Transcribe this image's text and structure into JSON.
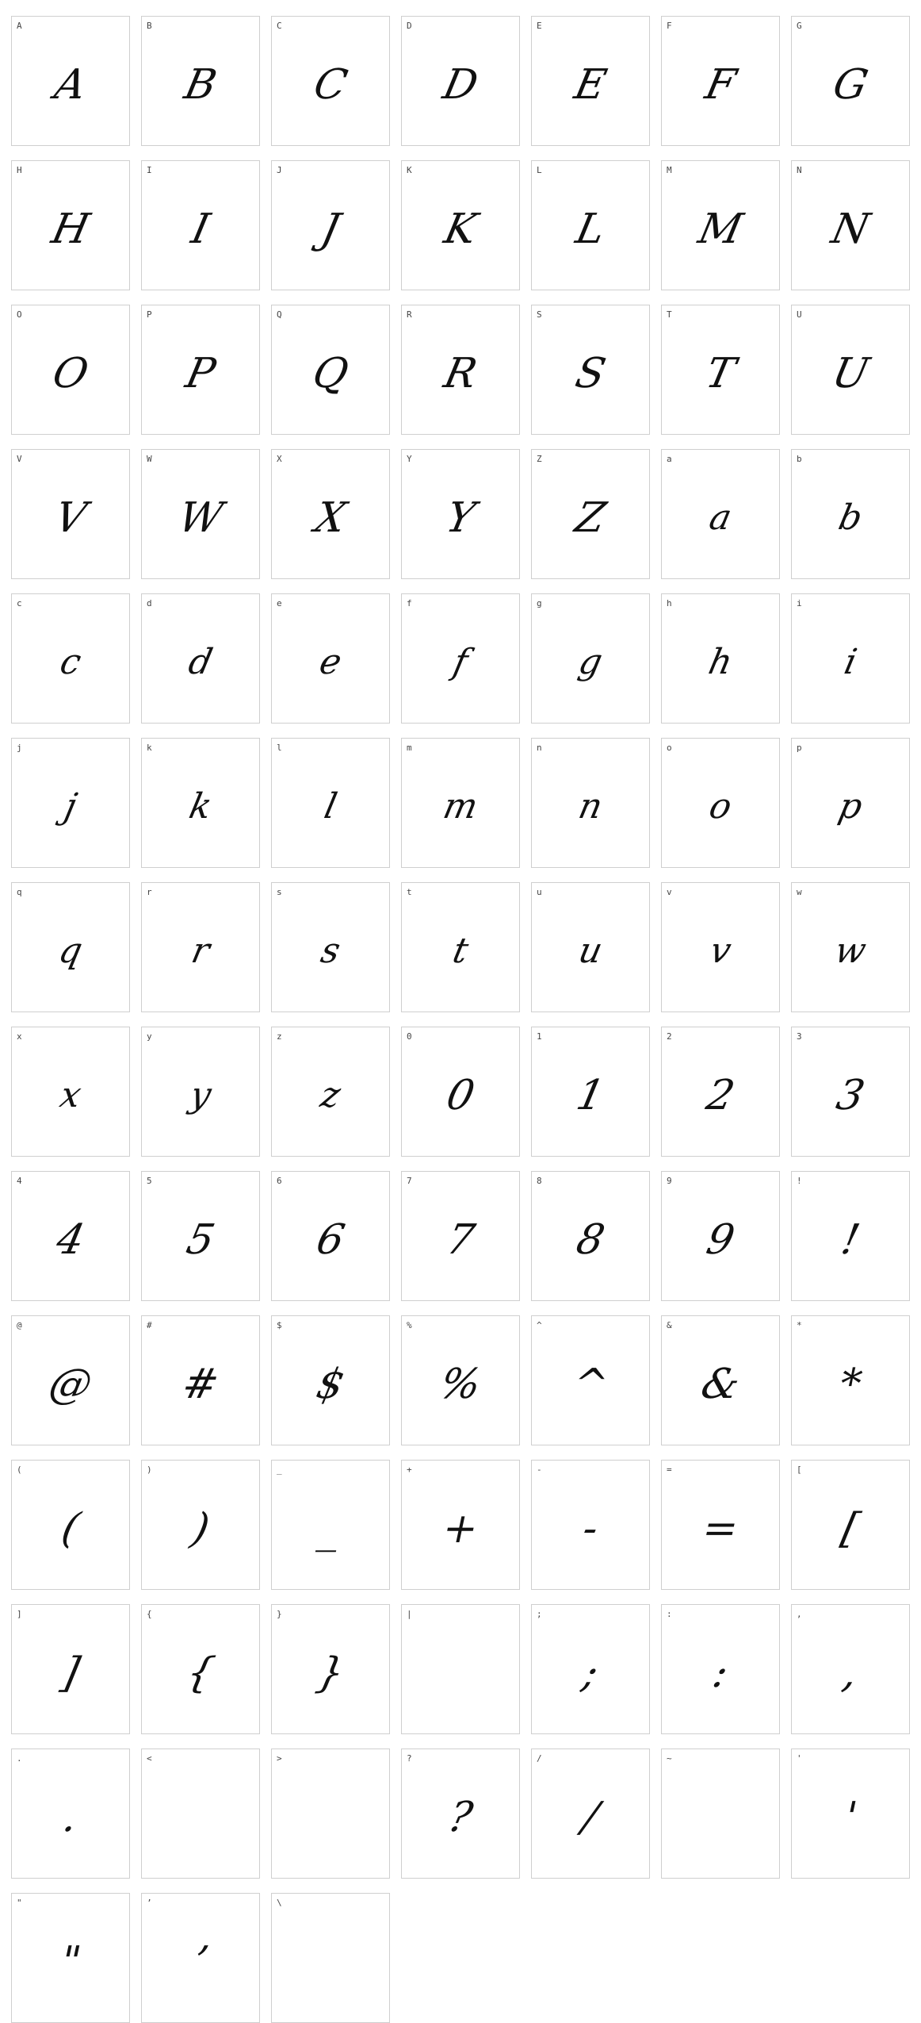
{
  "sample_text_color": "#111111",
  "cell_border_color": "#cfcfcf",
  "glyphs": [
    "A",
    "B",
    "C",
    "D",
    "E",
    "F",
    "G",
    "H",
    "I",
    "J",
    "K",
    "L",
    "M",
    "N",
    "O",
    "P",
    "Q",
    "R",
    "S",
    "T",
    "U",
    "V",
    "W",
    "X",
    "Y",
    "Z",
    "a",
    "b",
    "c",
    "d",
    "e",
    "f",
    "g",
    "h",
    "i",
    "j",
    "k",
    "l",
    "m",
    "n",
    "o",
    "p",
    "q",
    "r",
    "s",
    "t",
    "u",
    "v",
    "w",
    "x",
    "y",
    "z",
    "0",
    "1",
    "2",
    "3",
    "4",
    "5",
    "6",
    "7",
    "8",
    "9",
    "!",
    "@",
    "#",
    "$",
    "%",
    "^",
    "&",
    "*",
    "(",
    ")",
    "_",
    "+",
    "-",
    "=",
    "[",
    "]",
    "{",
    "}",
    "|",
    ";",
    ":",
    ",",
    ".",
    "<",
    ">",
    "?",
    "/",
    "~",
    "'",
    "\"",
    "’",
    "\\"
  ],
  "blank_glyphs": [
    "|",
    "<",
    ">",
    "~",
    "\\"
  ]
}
